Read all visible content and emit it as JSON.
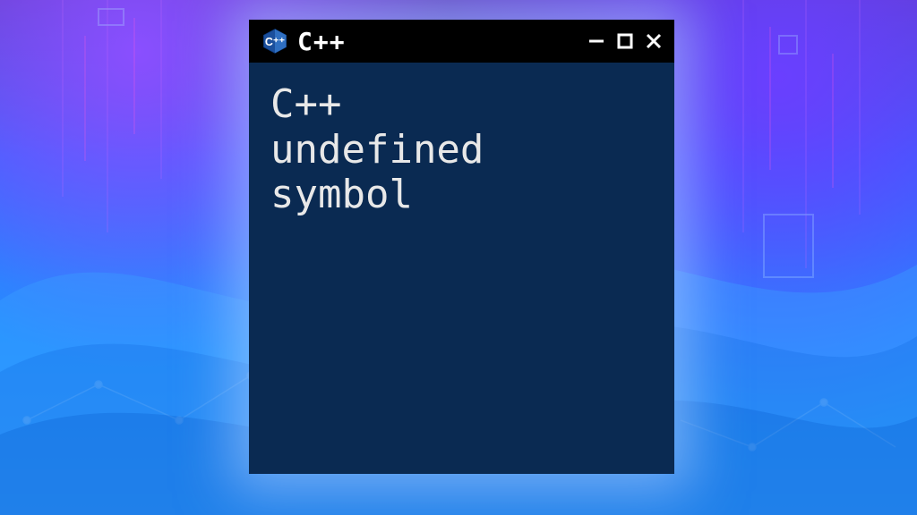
{
  "window": {
    "title": "C++",
    "icon": "cpp-logo-icon",
    "controls": {
      "minimize": "minimize-icon",
      "maximize": "maximize-icon",
      "close": "close-icon"
    }
  },
  "content": {
    "text": "C++\nundefined\nsymbol"
  },
  "colors": {
    "window_bg": "#000000",
    "content_bg": "#0a2a52",
    "text": "#e8e8e8",
    "accent_blue": "#1e8bff",
    "accent_purple": "#6a3fff"
  }
}
